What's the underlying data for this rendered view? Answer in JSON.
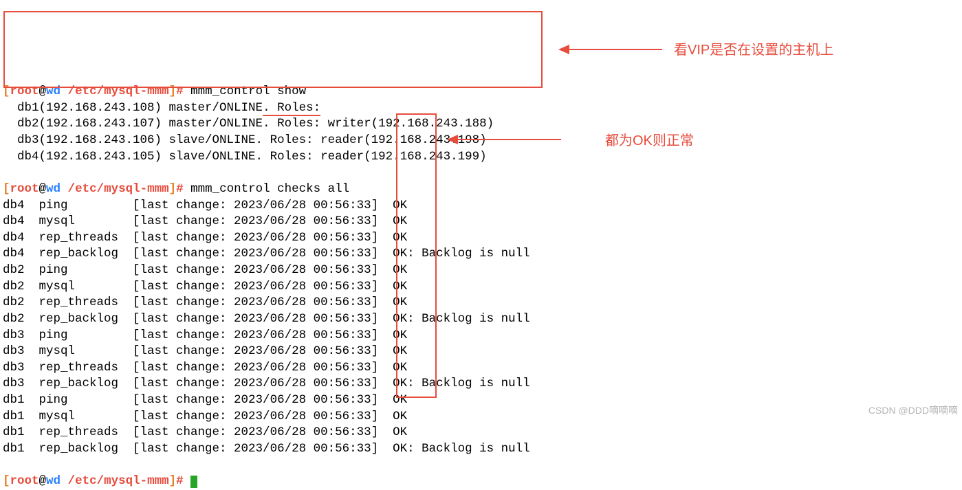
{
  "prompt": {
    "bracket_open": "[",
    "user": "root",
    "at": "@",
    "host": "wd",
    "path": " /etc/mysql-mmm",
    "bracket_close": "]",
    "hash": "# "
  },
  "cmd1": "mmm_control show",
  "show_output": {
    "l1a": "  db1(192.168.243.108) master/ONLINE",
    "l1b": ". Roles:",
    "l2": "  db2(192.168.243.107) master/ONLINE. Roles: writer(192.168.243.188)",
    "l3": "  db3(192.168.243.106) slave/ONLINE. Roles: reader(192.168.243.198)",
    "l4": "  db4(192.168.243.105) slave/ONLINE. Roles: reader(192.168.243.199)"
  },
  "cmd2": "mmm_control checks all",
  "checks": [
    {
      "prefix": "db4  ping         [last change: 2023/06/28 00:56:33]  OK",
      "suffix": ""
    },
    {
      "prefix": "db4  mysql        [last change: 2023/06/28 00:56:33]  OK",
      "suffix": ""
    },
    {
      "prefix": "db4  rep_threads  [last change: 2023/06/28 00:56:33]  OK",
      "suffix": ""
    },
    {
      "prefix": "db4  rep_backlog  [last change: 2023/06/28 00:56:33]  OK",
      "suffix": ": Backlog is null"
    },
    {
      "prefix": "db2  ping         [last change: 2023/06/28 00:56:33]  OK",
      "suffix": ""
    },
    {
      "prefix": "db2  mysql        [last change: 2023/06/28 00:56:33]  OK",
      "suffix": ""
    },
    {
      "prefix": "db2  rep_threads  [last change: 2023/06/28 00:56:33]  OK",
      "suffix": ""
    },
    {
      "prefix": "db2  rep_backlog  [last change: 2023/06/28 00:56:33]  OK",
      "suffix": ": Backlog is null"
    },
    {
      "prefix": "db3  ping         [last change: 2023/06/28 00:56:33]  OK",
      "suffix": ""
    },
    {
      "prefix": "db3  mysql        [last change: 2023/06/28 00:56:33]  OK",
      "suffix": ""
    },
    {
      "prefix": "db3  rep_threads  [last change: 2023/06/28 00:56:33]  OK",
      "suffix": ""
    },
    {
      "prefix": "db3  rep_backlog  [last change: 2023/06/28 00:56:33]  OK",
      "suffix": ": Backlog is null"
    },
    {
      "prefix": "db1  ping         [last change: 2023/06/28 00:56:33]  OK",
      "suffix": ""
    },
    {
      "prefix": "db1  mysql        [last change: 2023/06/28 00:56:33]  OK",
      "suffix": ""
    },
    {
      "prefix": "db1  rep_threads  [last change: 2023/06/28 00:56:33]  OK",
      "suffix": ""
    },
    {
      "prefix": "db1  rep_backlog  [last change: 2023/06/28 00:56:33]  OK",
      "suffix": ": Backlog is null"
    }
  ],
  "annotations": {
    "top": "看VIP是否在设置的主机上",
    "mid": "都为OK则正常"
  },
  "watermark": "CSDN @DDD嘀嘀嘀"
}
